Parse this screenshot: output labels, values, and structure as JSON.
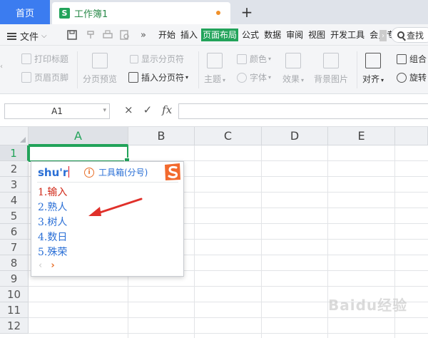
{
  "tabs": {
    "home_label": "首页",
    "doc_icon_letter": "S",
    "doc_title": "工作簿1",
    "add_label": "+"
  },
  "menu": {
    "file_label": "文件",
    "tabs": [
      {
        "label": "开始",
        "active": false
      },
      {
        "label": "插入",
        "active": false
      },
      {
        "label": "页面布局",
        "active": true
      },
      {
        "label": "公式",
        "active": false
      },
      {
        "label": "数据",
        "active": false
      },
      {
        "label": "审阅",
        "active": false
      },
      {
        "label": "视图",
        "active": false
      },
      {
        "label": "开发工具",
        "active": false
      },
      {
        "label": "会员专",
        "active": false
      }
    ],
    "search_label": "查找"
  },
  "ribbon": {
    "print_titles": "打印标题",
    "header_footer": "页眉页脚",
    "page_break_preview": "分页预览",
    "show_page_breaks": "显示分页符",
    "insert_page_break": "插入分页符",
    "theme": "主题",
    "colors": "颜色",
    "fonts": "字体",
    "effects": "效果",
    "background_image": "背景图片",
    "align": "对齐",
    "group": "组合",
    "rotate": "旋转"
  },
  "formula_bar": {
    "cell_ref": "A1",
    "cancel_symbol": "×",
    "confirm_symbol": "✓",
    "fx_label": "fx",
    "value": ""
  },
  "grid": {
    "columns": [
      "A",
      "B",
      "C",
      "D",
      "E"
    ],
    "rows": [
      "1",
      "2",
      "3",
      "4",
      "5",
      "6",
      "7",
      "8",
      "9",
      "10",
      "11",
      "12"
    ],
    "selected_column": "A",
    "selected_row": "1"
  },
  "ime": {
    "pinyin": "shu'r",
    "toolbox_label": "工具箱(分号)",
    "info_symbol": "i",
    "candidates": [
      "1.输入",
      "2.熟人",
      "3.树人",
      "4.数日",
      "5.殊荣"
    ],
    "prev_symbol": "‹",
    "next_symbol": "›"
  },
  "colors": {
    "accent_green": "#22a35a",
    "tab_blue": "#3b7cf0",
    "ime_blue": "#2a6fd6",
    "ime_red": "#d12a1a",
    "arrow_red": "#e0302a"
  },
  "watermark": "Baidu经验"
}
